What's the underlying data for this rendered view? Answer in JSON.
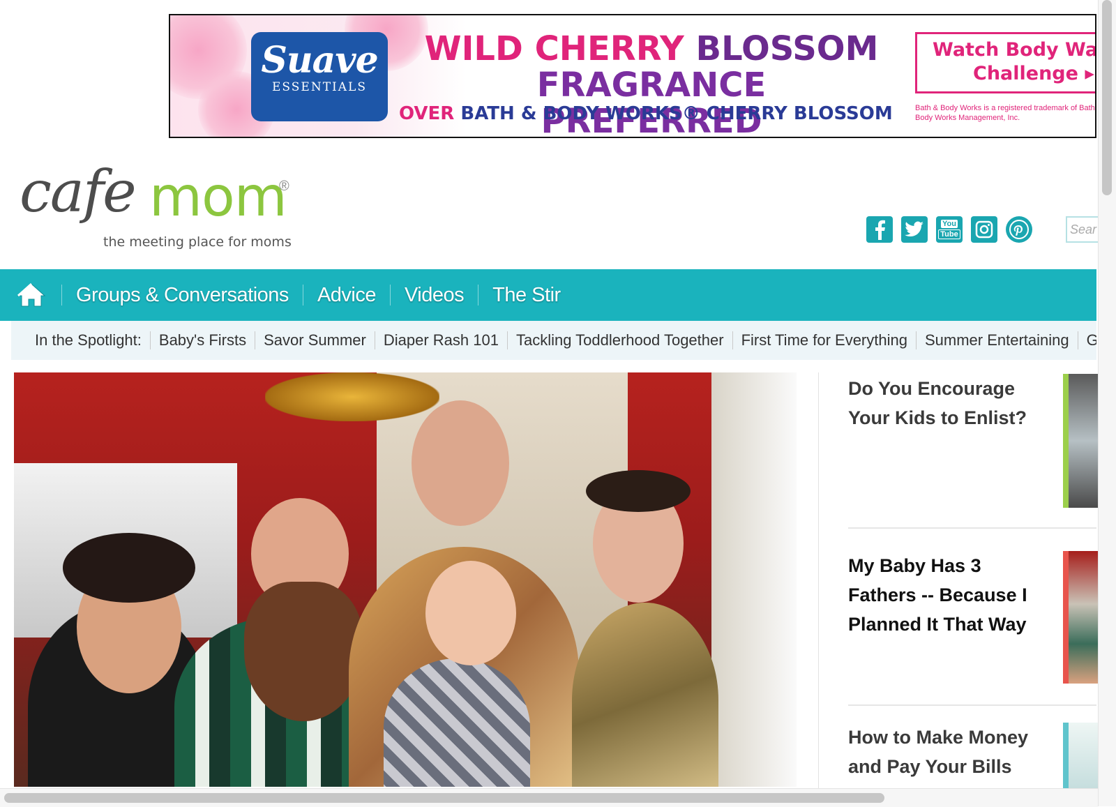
{
  "ad": {
    "brand": "Suave",
    "brand_sub": "ESSENTIALS",
    "headline_1a": "WILD CHERRY",
    "headline_1b": "BLOSSOM",
    "headline_2": "FRAGRANCE PREFERRED",
    "subline_a": "OVER",
    "subline_b": "BATH & BODY WORKS® CHERRY BLOSSOM",
    "cta_line1": "Watch Body Wa",
    "cta_line2": "Challenge ▸",
    "legal": "Bath & Body Works is a registered trademark of Bath & Body Works Management, Inc."
  },
  "header": {
    "logo_cafe": "cafe",
    "logo_mom": "mom",
    "logo_reg": "®",
    "tagline": "the meeting place for moms",
    "social": [
      {
        "icon": "facebook-icon",
        "glyph": "f"
      },
      {
        "icon": "twitter-icon",
        "glyph": "🐦"
      },
      {
        "icon": "youtube-icon",
        "glyph": "You\nTube"
      },
      {
        "icon": "instagram-icon",
        "glyph": "◎"
      },
      {
        "icon": "pinterest-icon",
        "glyph": "P"
      }
    ],
    "search_placeholder": "Sear"
  },
  "nav": {
    "home_icon": "home-icon",
    "items": [
      "Groups & Conversations",
      "Advice",
      "Videos",
      "The Stir"
    ]
  },
  "spotlight": {
    "label": "In the Spotlight:",
    "links": [
      "Baby's Firsts",
      "Savor Summer",
      "Diaper Rash 101",
      "Tackling Toddlerhood Together",
      "First Time for Everything",
      "Summer Entertaining",
      "G"
    ]
  },
  "sidebar": {
    "stories": [
      {
        "title": "Do You Encourage Your Kids to Enlist?",
        "accent": "#9ccf4b"
      },
      {
        "title": "My Baby Has 3 Fathers -- Because I Planned It That Way",
        "accent": "#e8544c"
      },
      {
        "title": "How to Make Money and Pay Your Bills",
        "accent": "#5fc4cc"
      }
    ]
  },
  "colors": {
    "teal": "#1ab3bd",
    "green": "#8cc63f",
    "pink": "#e0247a",
    "navy": "#2a3b96"
  }
}
